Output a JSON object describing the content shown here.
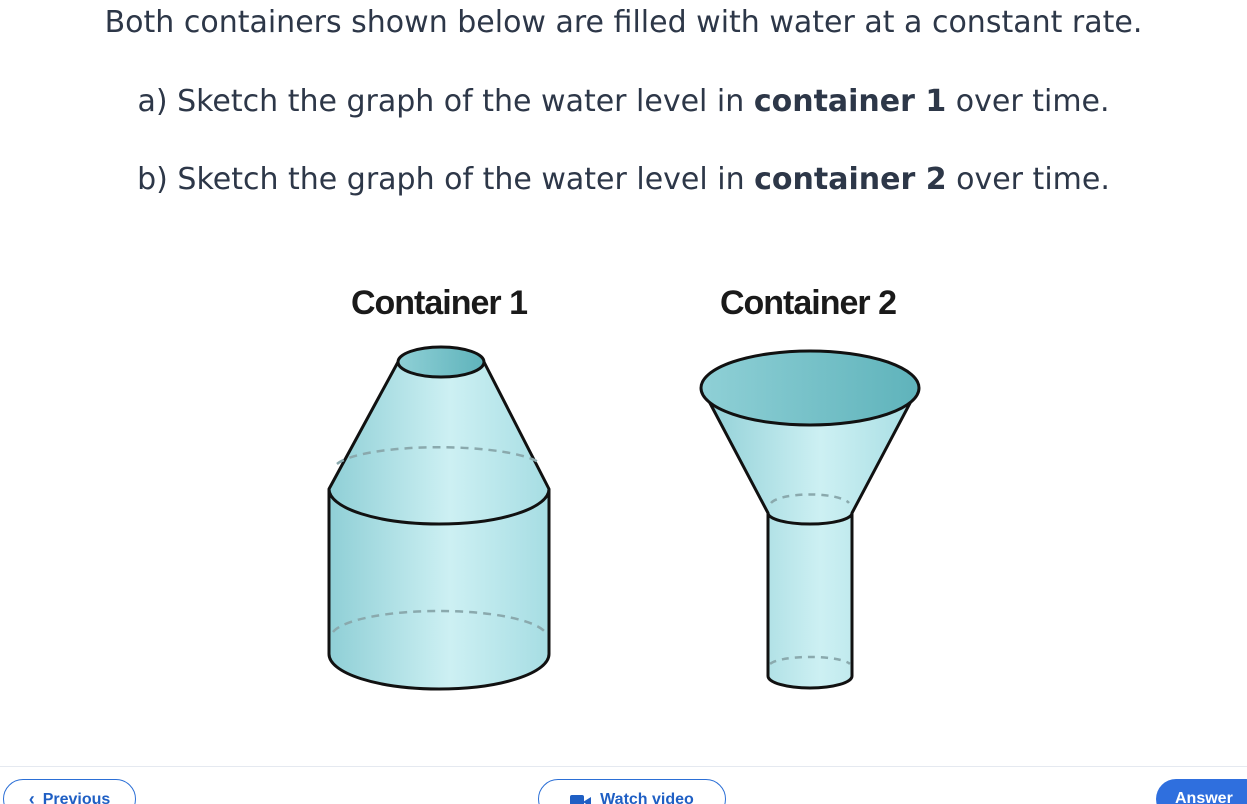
{
  "question": {
    "intro": "Both containers shown below are filled with water at a constant rate.",
    "part_a": {
      "prefix": "a) Sketch the graph of the water level in ",
      "emphasis": "container 1",
      "suffix": " over time."
    },
    "part_b": {
      "prefix": "b) Sketch the graph of the water level in ",
      "emphasis": "container 2",
      "suffix": " over time."
    }
  },
  "figure": {
    "container1_label": "Container 1",
    "container2_label": "Container 2"
  },
  "nav": {
    "previous_label": "Previous",
    "video_label": "Watch video",
    "answer_label": "Answer"
  },
  "colors": {
    "text": "#2d3748",
    "accent": "#2f6fde",
    "water": "#a9dde2"
  }
}
